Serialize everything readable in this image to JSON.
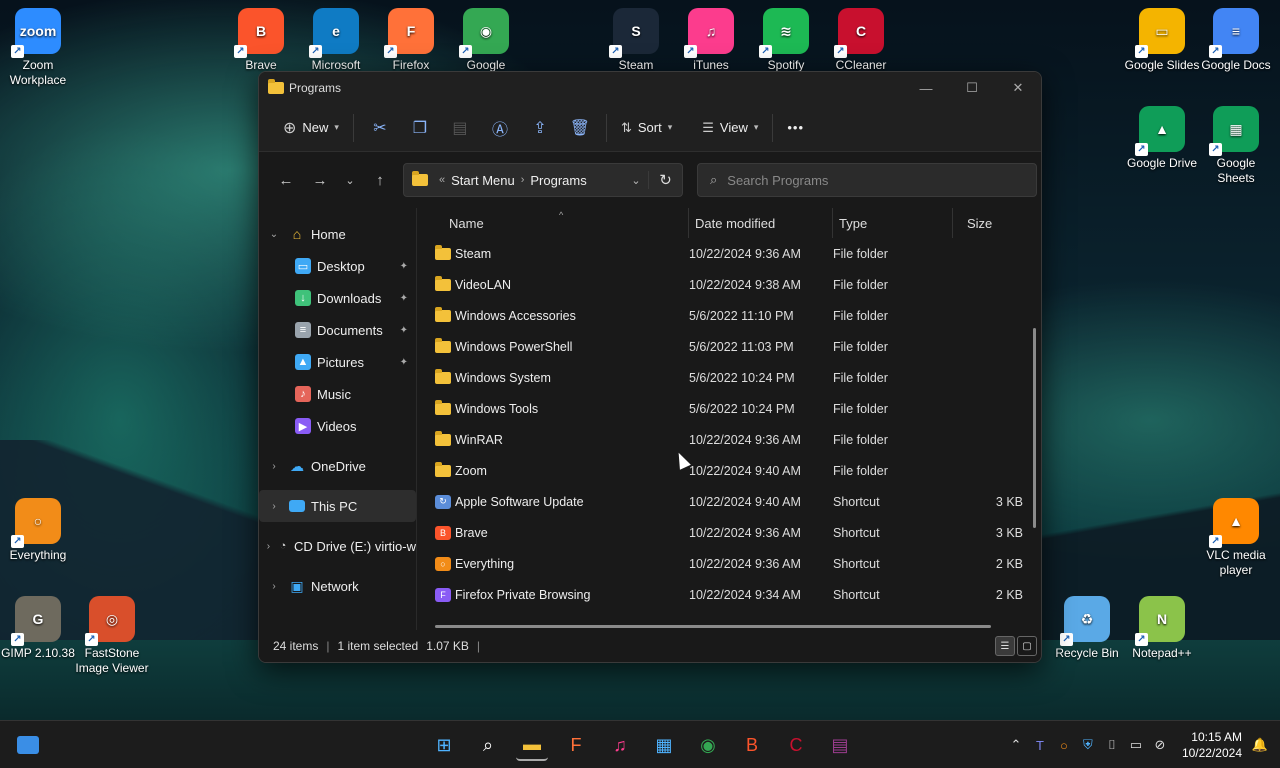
{
  "desktop": {
    "icons_top": [
      {
        "label": "Zoom Workplace",
        "icon": "zoom-icon",
        "glyph": "zoom",
        "color": "#2d8cff"
      },
      {
        "label": "Brave",
        "icon": "brave-icon",
        "glyph": "B",
        "color": "#fb542b"
      },
      {
        "label": "Microsoft",
        "icon": "edge-icon",
        "glyph": "e",
        "color": "#0f7bc4"
      },
      {
        "label": "Firefox",
        "icon": "firefox-icon",
        "glyph": "F",
        "color": "#ff7139"
      },
      {
        "label": "Google",
        "icon": "chrome-icon",
        "glyph": "◉",
        "color": "#34a853"
      },
      {
        "label": "Steam",
        "icon": "steam-icon",
        "glyph": "S",
        "color": "#1b2838"
      },
      {
        "label": "iTunes",
        "icon": "itunes-icon",
        "glyph": "♫",
        "color": "#fc3c8d"
      },
      {
        "label": "Spotify",
        "icon": "spotify-icon",
        "glyph": "≋",
        "color": "#1db954"
      },
      {
        "label": "CCleaner",
        "icon": "ccleaner-icon",
        "glyph": "C",
        "color": "#c8102e"
      },
      {
        "label": "Google Slides",
        "icon": "google-slides-icon",
        "glyph": "▭",
        "color": "#f4b400"
      },
      {
        "label": "Google Docs",
        "icon": "google-docs-icon",
        "glyph": "≡",
        "color": "#4285f4"
      },
      {
        "label": "Google Drive",
        "icon": "google-drive-icon",
        "glyph": "▲",
        "color": "#0f9d58"
      },
      {
        "label": "Google Sheets",
        "icon": "google-sheets-icon",
        "glyph": "▦",
        "color": "#0f9d58"
      },
      {
        "label": "Everything",
        "icon": "everything-icon",
        "glyph": "○",
        "color": "#f28c18"
      },
      {
        "label": "VLC media player",
        "icon": "vlc-icon",
        "glyph": "▲",
        "color": "#ff8800"
      },
      {
        "label": "GIMP 2.10.38",
        "icon": "gimp-icon",
        "glyph": "G",
        "color": "#6e6a5e"
      },
      {
        "label": "FastStone Image Viewer",
        "icon": "faststone-icon",
        "glyph": "◎",
        "color": "#d94f2b"
      },
      {
        "label": "Recycle Bin",
        "icon": "recycle-bin-icon",
        "glyph": "♻",
        "color": "#5aa9e6"
      },
      {
        "label": "Notepad++",
        "icon": "notepadpp-icon",
        "glyph": "N",
        "color": "#8bc34a"
      }
    ]
  },
  "window": {
    "title": "Programs",
    "toolbar": {
      "new_label": "New",
      "sort_label": "Sort",
      "view_label": "View",
      "more_label": "•••"
    },
    "breadcrumb": [
      "Start Menu",
      "Programs"
    ],
    "search_placeholder": "Search Programs",
    "sidebar": {
      "home": "Home",
      "quick": [
        {
          "label": "Desktop",
          "icon": "desktop-icon",
          "color": "#3fa9f5",
          "glyph": "▭"
        },
        {
          "label": "Downloads",
          "icon": "downloads-icon",
          "color": "#3fc27a",
          "glyph": "↓"
        },
        {
          "label": "Documents",
          "icon": "documents-icon",
          "color": "#9aa4ad",
          "glyph": "≡"
        },
        {
          "label": "Pictures",
          "icon": "pictures-icon",
          "color": "#3fa9f5",
          "glyph": "▲"
        },
        {
          "label": "Music",
          "icon": "music-icon",
          "color": "#e5655a",
          "glyph": "♪"
        },
        {
          "label": "Videos",
          "icon": "videos-icon",
          "color": "#8a5cf5",
          "glyph": "▶"
        }
      ],
      "onedrive": "OneDrive",
      "this_pc": "This PC",
      "cd_drive": "CD Drive (E:) virtio-w",
      "network": "Network"
    },
    "columns": {
      "name": "Name",
      "date": "Date modified",
      "type": "Type",
      "size": "Size"
    },
    "files": [
      {
        "name": "Steam",
        "date": "10/22/2024 9:36 AM",
        "type": "File folder",
        "size": "",
        "kind": "folder"
      },
      {
        "name": "VideoLAN",
        "date": "10/22/2024 9:38 AM",
        "type": "File folder",
        "size": "",
        "kind": "folder"
      },
      {
        "name": "Windows Accessories",
        "date": "5/6/2022 11:10 PM",
        "type": "File folder",
        "size": "",
        "kind": "folder"
      },
      {
        "name": "Windows PowerShell",
        "date": "5/6/2022 11:03 PM",
        "type": "File folder",
        "size": "",
        "kind": "folder"
      },
      {
        "name": "Windows System",
        "date": "5/6/2022 10:24 PM",
        "type": "File folder",
        "size": "",
        "kind": "folder"
      },
      {
        "name": "Windows Tools",
        "date": "5/6/2022 10:24 PM",
        "type": "File folder",
        "size": "",
        "kind": "folder"
      },
      {
        "name": "WinRAR",
        "date": "10/22/2024 9:36 AM",
        "type": "File folder",
        "size": "",
        "kind": "folder"
      },
      {
        "name": "Zoom",
        "date": "10/22/2024 9:40 AM",
        "type": "File folder",
        "size": "",
        "kind": "folder"
      },
      {
        "name": "Apple Software Update",
        "date": "10/22/2024 9:40 AM",
        "type": "Shortcut",
        "size": "3 KB",
        "kind": "shortcut",
        "color": "#5b8dd9",
        "glyph": "↻"
      },
      {
        "name": "Brave",
        "date": "10/22/2024 9:36 AM",
        "type": "Shortcut",
        "size": "3 KB",
        "kind": "shortcut",
        "color": "#fb542b",
        "glyph": "B"
      },
      {
        "name": "Everything",
        "date": "10/22/2024 9:36 AM",
        "type": "Shortcut",
        "size": "2 KB",
        "kind": "shortcut",
        "color": "#f28c18",
        "glyph": "○"
      },
      {
        "name": "Firefox Private Browsing",
        "date": "10/22/2024 9:34 AM",
        "type": "Shortcut",
        "size": "2 KB",
        "kind": "shortcut",
        "color": "#8a5cf5",
        "glyph": "F"
      }
    ],
    "status": {
      "items": "24 items",
      "selected": "1 item selected",
      "size": "1.07 KB"
    }
  },
  "taskbar": {
    "apps": [
      {
        "icon": "start-icon",
        "glyph": "⊞",
        "color": "#4fb3ff"
      },
      {
        "icon": "search-icon",
        "glyph": "⌕",
        "color": "#ffffff"
      },
      {
        "icon": "file-explorer-icon",
        "glyph": "▬",
        "color": "#f3c13a"
      },
      {
        "icon": "firefox-icon",
        "glyph": "F",
        "color": "#ff7139"
      },
      {
        "icon": "itunes-icon",
        "glyph": "♫",
        "color": "#fc3c8d"
      },
      {
        "icon": "store-icon",
        "glyph": "▦",
        "color": "#4fb3ff"
      },
      {
        "icon": "chrome-icon",
        "glyph": "◉",
        "color": "#34a853"
      },
      {
        "icon": "brave-icon",
        "glyph": "B",
        "color": "#fb542b"
      },
      {
        "icon": "ccleaner-icon",
        "glyph": "C",
        "color": "#c8102e"
      },
      {
        "icon": "winrar-icon",
        "glyph": "▤",
        "color": "#9c3d8f"
      }
    ],
    "time": "10:15 AM",
    "date": "10/22/2024"
  }
}
